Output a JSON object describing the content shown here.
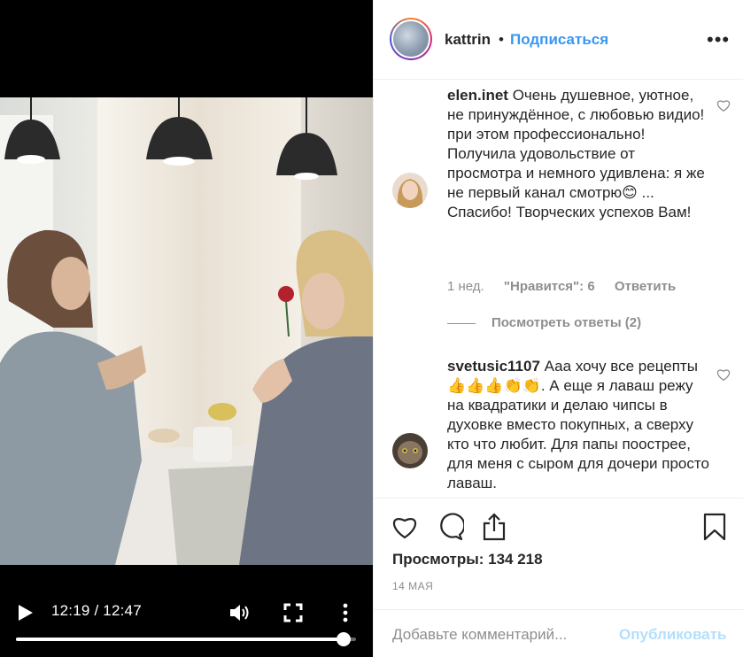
{
  "video": {
    "time_display": "12:19 / 12:47",
    "progress_fraction": 0.964
  },
  "header": {
    "username": "kattrin",
    "separator": "•",
    "follow_label": "Подписаться",
    "more_label": "•••"
  },
  "comments": [
    {
      "username": "elen.inet",
      "text": "Очень душевное, уютное, не принуждённое, с любовью видио! при этом профессионально! Получила удовольствие от просмотра и немного удивлена: я же не первый канал смотрю😊 ... Спасибо! Творческих успехов Вам!",
      "time": "1 нед.",
      "likes": "\"Нравится\": 6",
      "reply_label": "Ответить",
      "view_replies": "Посмотреть ответы (2)"
    },
    {
      "username": "svetusic1107",
      "text": "Ааа хочу все рецепты👍👍👍👏👏. А еще я лаваш режу на квадратики и делаю чипсы в духовке вместо покупных, а сверху кто что любит. Для папы поострее, для меня с сыром для дочери просто лаваш."
    }
  ],
  "actions": {
    "views": "Просмотры: 134 218",
    "date": "14 МАЯ"
  },
  "add_comment": {
    "placeholder": "Добавьте комментарий...",
    "publish_label": "Опубликовать"
  },
  "colors": {
    "link_blue": "#3897f0",
    "publish_disabled": "#b2dffc",
    "muted": "#8e8e8e",
    "text": "#262626"
  },
  "icons": {
    "play": "play-icon",
    "volume": "volume-icon",
    "fullscreen": "fullscreen-icon",
    "video_more": "vertical-dots-icon",
    "heart": "heart-icon",
    "comment": "comment-icon",
    "share": "share-icon",
    "save": "bookmark-icon"
  }
}
